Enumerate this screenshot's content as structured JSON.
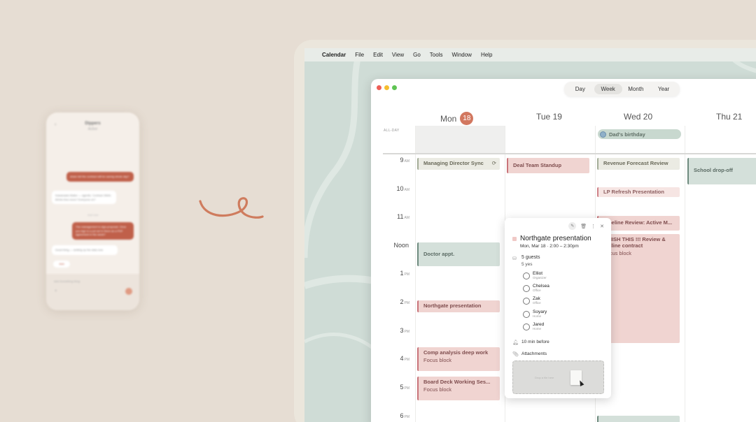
{
  "phone": {
    "title": "Dippers",
    "subtitle": "Active",
    "back_glyph": "‹",
    "messages": [
      {
        "dir": "out",
        "text": "share tell the contract will be saving whole day?"
      },
      {
        "dir": "in",
        "text": "Kawanaalo Mailer — agentic: Contract 30k/k-80min-free-more? Everyone on?"
      },
      {
        "dir": "out",
        "text": "The management is sign-proposal. Once you sign is a put set in there as a PDF agreement in the week?"
      },
      {
        "dir": "in",
        "text": "Good thing — settling up the data now"
      }
    ],
    "timestamp": "Just now",
    "pill": "Add",
    "composer_placeholder": "Add Something thing",
    "composer_plus": "+"
  },
  "menubar": {
    "apple": "",
    "app": "Calendar",
    "items": [
      "File",
      "Edit",
      "View",
      "Go",
      "Tools",
      "Window",
      "Help"
    ]
  },
  "calendar": {
    "views": [
      "Day",
      "Week",
      "Month",
      "Year"
    ],
    "active_view": "Week",
    "days": [
      {
        "label": "Mon",
        "num": "18",
        "today": true
      },
      {
        "label": "Tue 19"
      },
      {
        "label": "Wed 20"
      },
      {
        "label": "Thu 21"
      }
    ],
    "allday_label": "ALL-DAY",
    "allday_event": "Dad's birthday",
    "hours": [
      {
        "h": "9",
        "ap": "AM"
      },
      {
        "h": "10",
        "ap": "AM"
      },
      {
        "h": "11",
        "ap": "AM"
      },
      {
        "h": "Noon",
        "ap": ""
      },
      {
        "h": "1",
        "ap": "PM"
      },
      {
        "h": "2",
        "ap": "PM"
      },
      {
        "h": "3",
        "ap": "PM"
      },
      {
        "h": "4",
        "ap": "PM"
      },
      {
        "h": "5",
        "ap": "PM"
      },
      {
        "h": "6",
        "ap": "PM"
      }
    ],
    "events": {
      "mds": "Managing Director Sync",
      "doctor": "Doctor appt.",
      "northgate": "Northgate presentation",
      "comp": "Comp analysis deep work",
      "comp_sub": "Focus block",
      "board": "Board Deck Working Ses...",
      "board_sub": "Focus block",
      "deal": "Deal Team Standup",
      "revenue": "Revenue Forecast Review",
      "lp": "LP Refresh Presentation",
      "pipeline": "Pipeline Review: Active M...",
      "finish": "FINISH THIS !!! Review & redline contract",
      "finish_sub": "Focus block",
      "school": "School drop-off"
    },
    "colors": {
      "today": "#d2775f",
      "green": "#d4e0da",
      "red": "#f0d4d1"
    }
  },
  "popover": {
    "title": "Northgate presentation",
    "when": "Mon, Mar 18 · 2:00 – 2:30pm",
    "guests": "5 guests",
    "yes": "5 yes",
    "people": [
      {
        "name": "Elliot",
        "role": "Organizer"
      },
      {
        "name": "Chelsea",
        "role": "Office"
      },
      {
        "name": "Zak",
        "role": "Office"
      },
      {
        "name": "Soyary",
        "role": "Home"
      },
      {
        "name": "Jared",
        "role": "Home"
      }
    ],
    "reminder": "10 min before",
    "attachments": "Attachments",
    "drop_hint": "Drop a file here"
  }
}
